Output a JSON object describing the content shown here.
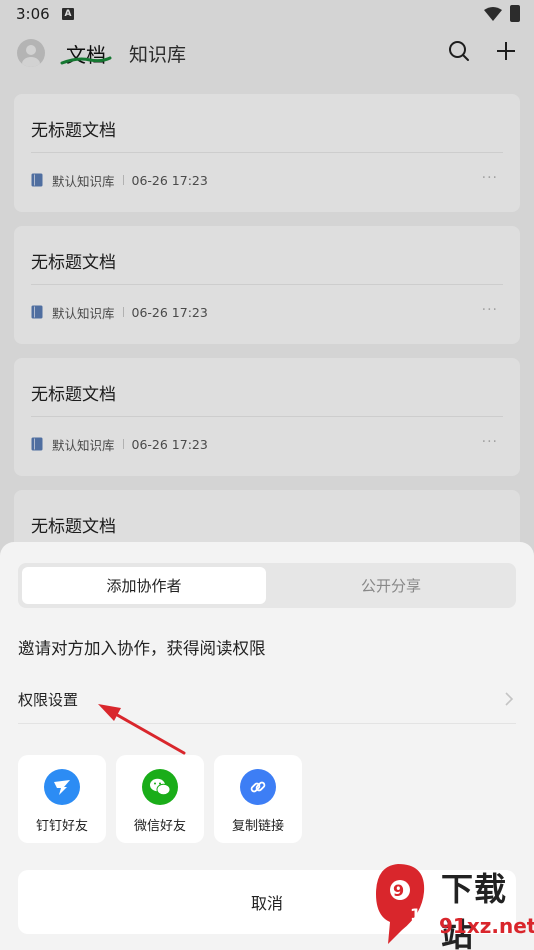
{
  "status_bar": {
    "time": "3:06",
    "a_badge": "A"
  },
  "header": {
    "tab_active": "文档",
    "tab_inactive": "知识库",
    "icons": [
      "avatar-icon",
      "search-icon",
      "plus-icon"
    ]
  },
  "doc_cards": [
    {
      "title": "无标题文档",
      "library": "默认知识库",
      "time": "06-26 17:23",
      "more": "···"
    },
    {
      "title": "无标题文档",
      "library": "默认知识库",
      "time": "06-26 17:23",
      "more": "···"
    },
    {
      "title": "无标题文档",
      "library": "默认知识库",
      "time": "06-26 17:23",
      "more": "···"
    },
    {
      "title": "无标题文档"
    }
  ],
  "share_sheet": {
    "tabs": [
      "添加协作者",
      "公开分享"
    ],
    "selected_tab": "添加协作者",
    "invite_text": "邀请对方加入协作，获得阅读权限",
    "permission_label": "权限设置",
    "share_options": [
      {
        "label": "钉钉好友",
        "icon": "dingtalk-icon",
        "color": "#2c8cf4"
      },
      {
        "label": "微信好友",
        "icon": "wechat-icon",
        "color": "#1aad19"
      },
      {
        "label": "复制链接",
        "icon": "link-icon",
        "color": "#3d7ef5"
      }
    ],
    "cancel_label": "取消"
  },
  "watermark": {
    "line1": "下载站",
    "line2": "91xz.net"
  },
  "colors": {
    "accent_underline": "#1a8a3a",
    "arrow": "#d9262c"
  }
}
